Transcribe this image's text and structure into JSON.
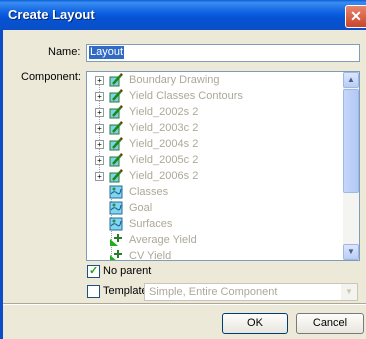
{
  "window": {
    "title": "Create Layout",
    "close": "✕"
  },
  "name": {
    "label": "Name:",
    "value": "Layout"
  },
  "component": {
    "label": "Component:",
    "items": [
      {
        "label": "Boundary Drawing",
        "icon": "layer-pen-icon",
        "expand": "+"
      },
      {
        "label": "Yield Classes Contours",
        "icon": "layer-pen-icon",
        "expand": "+"
      },
      {
        "label": "Yield_2002s 2",
        "icon": "layer-pen-icon",
        "expand": "+"
      },
      {
        "label": "Yield_2003c 2",
        "icon": "layer-pen-icon",
        "expand": "+"
      },
      {
        "label": "Yield_2004s 2",
        "icon": "layer-pen-icon",
        "expand": "+"
      },
      {
        "label": "Yield_2005c 2",
        "icon": "layer-pen-icon",
        "expand": "+"
      },
      {
        "label": "Yield_2006s 2",
        "icon": "layer-pen-icon",
        "expand": "+"
      },
      {
        "label": "Classes",
        "icon": "surface-map-icon"
      },
      {
        "label": "Goal",
        "icon": "surface-map-icon"
      },
      {
        "label": "Surfaces",
        "icon": "surface-map-icon"
      },
      {
        "label": "Average Yield",
        "icon": "statistics-icon"
      },
      {
        "label": "CV Yield",
        "icon": "statistics-icon"
      }
    ],
    "scroll_up": "▲",
    "scroll_down": "▼"
  },
  "no_parent": {
    "label": "No parent",
    "checked": true,
    "mark": "✓"
  },
  "template": {
    "label": "Template",
    "checked": false,
    "value": "Simple, Entire Component",
    "arrow": "▼"
  },
  "buttons": {
    "ok": "OK",
    "cancel": "Cancel"
  }
}
